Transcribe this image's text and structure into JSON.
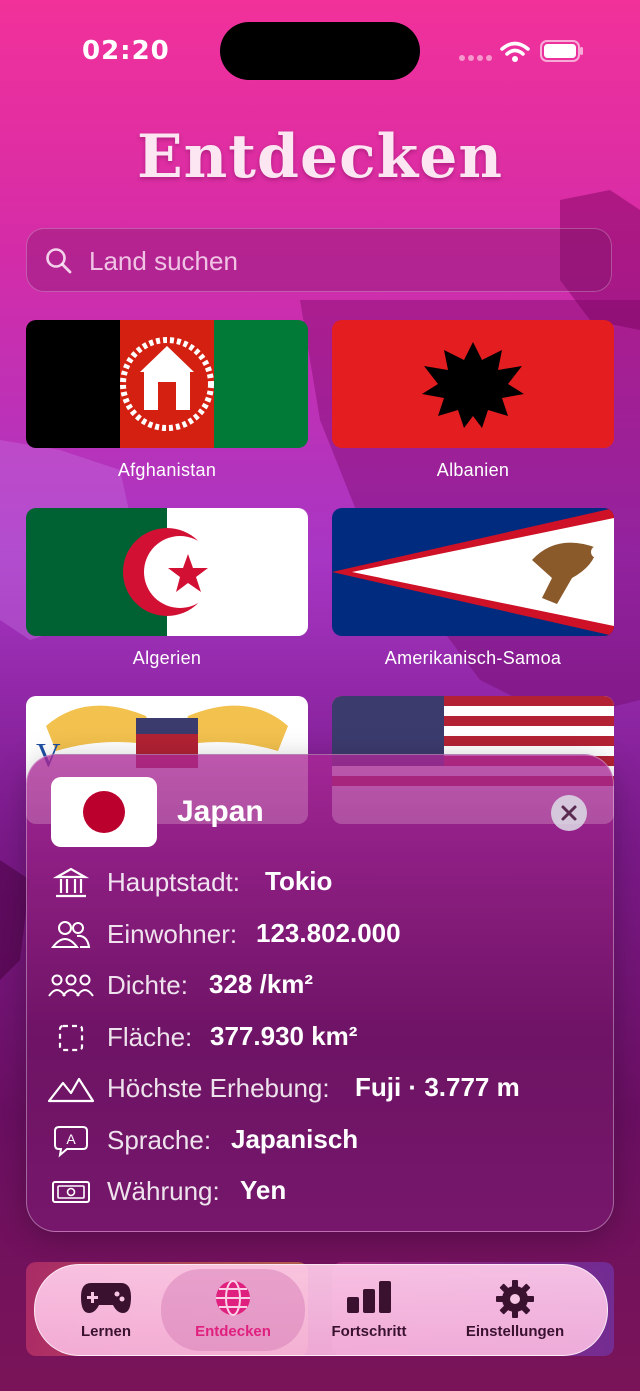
{
  "status_bar": {
    "time": "02:20"
  },
  "header": {
    "title": "Entdecken"
  },
  "search": {
    "placeholder": "Land suchen"
  },
  "countries": [
    {
      "name": "Afghanistan"
    },
    {
      "name": "Albanien"
    },
    {
      "name": "Algerien"
    },
    {
      "name": "Amerikanisch-Samoa"
    }
  ],
  "detail": {
    "country": "Japan",
    "rows": [
      {
        "icon": "museum-icon",
        "label": "Hauptstadt:",
        "value": "Tokio"
      },
      {
        "icon": "people-icon",
        "label": "Einwohner:",
        "value": "123.802.000"
      },
      {
        "icon": "group-icon",
        "label": "Dichte:",
        "value": "328 /km²"
      },
      {
        "icon": "area-icon",
        "label": "Fläche:",
        "value": "377.930 km²"
      },
      {
        "icon": "mountain-icon",
        "label": "Höchste Erhebung:",
        "value": "Fuji · 3.777 m"
      },
      {
        "icon": "speech-bubble-icon",
        "label": "Sprache:",
        "value": "Japanisch"
      },
      {
        "icon": "banknote-icon",
        "label": "Währung:",
        "value": "Yen"
      }
    ]
  },
  "tabbar": {
    "tabs": [
      {
        "label": "Lernen",
        "icon": "gamecontroller-icon"
      },
      {
        "label": "Entdecken",
        "icon": "globe-icon",
        "active": true
      },
      {
        "label": "Fortschritt",
        "icon": "bar-chart-icon"
      },
      {
        "label": "Einstellungen",
        "icon": "gear-icon"
      }
    ]
  },
  "colors": {
    "accent": "#e0207e",
    "background_top": "#f2319a",
    "background_bottom": "#6a0f62"
  }
}
